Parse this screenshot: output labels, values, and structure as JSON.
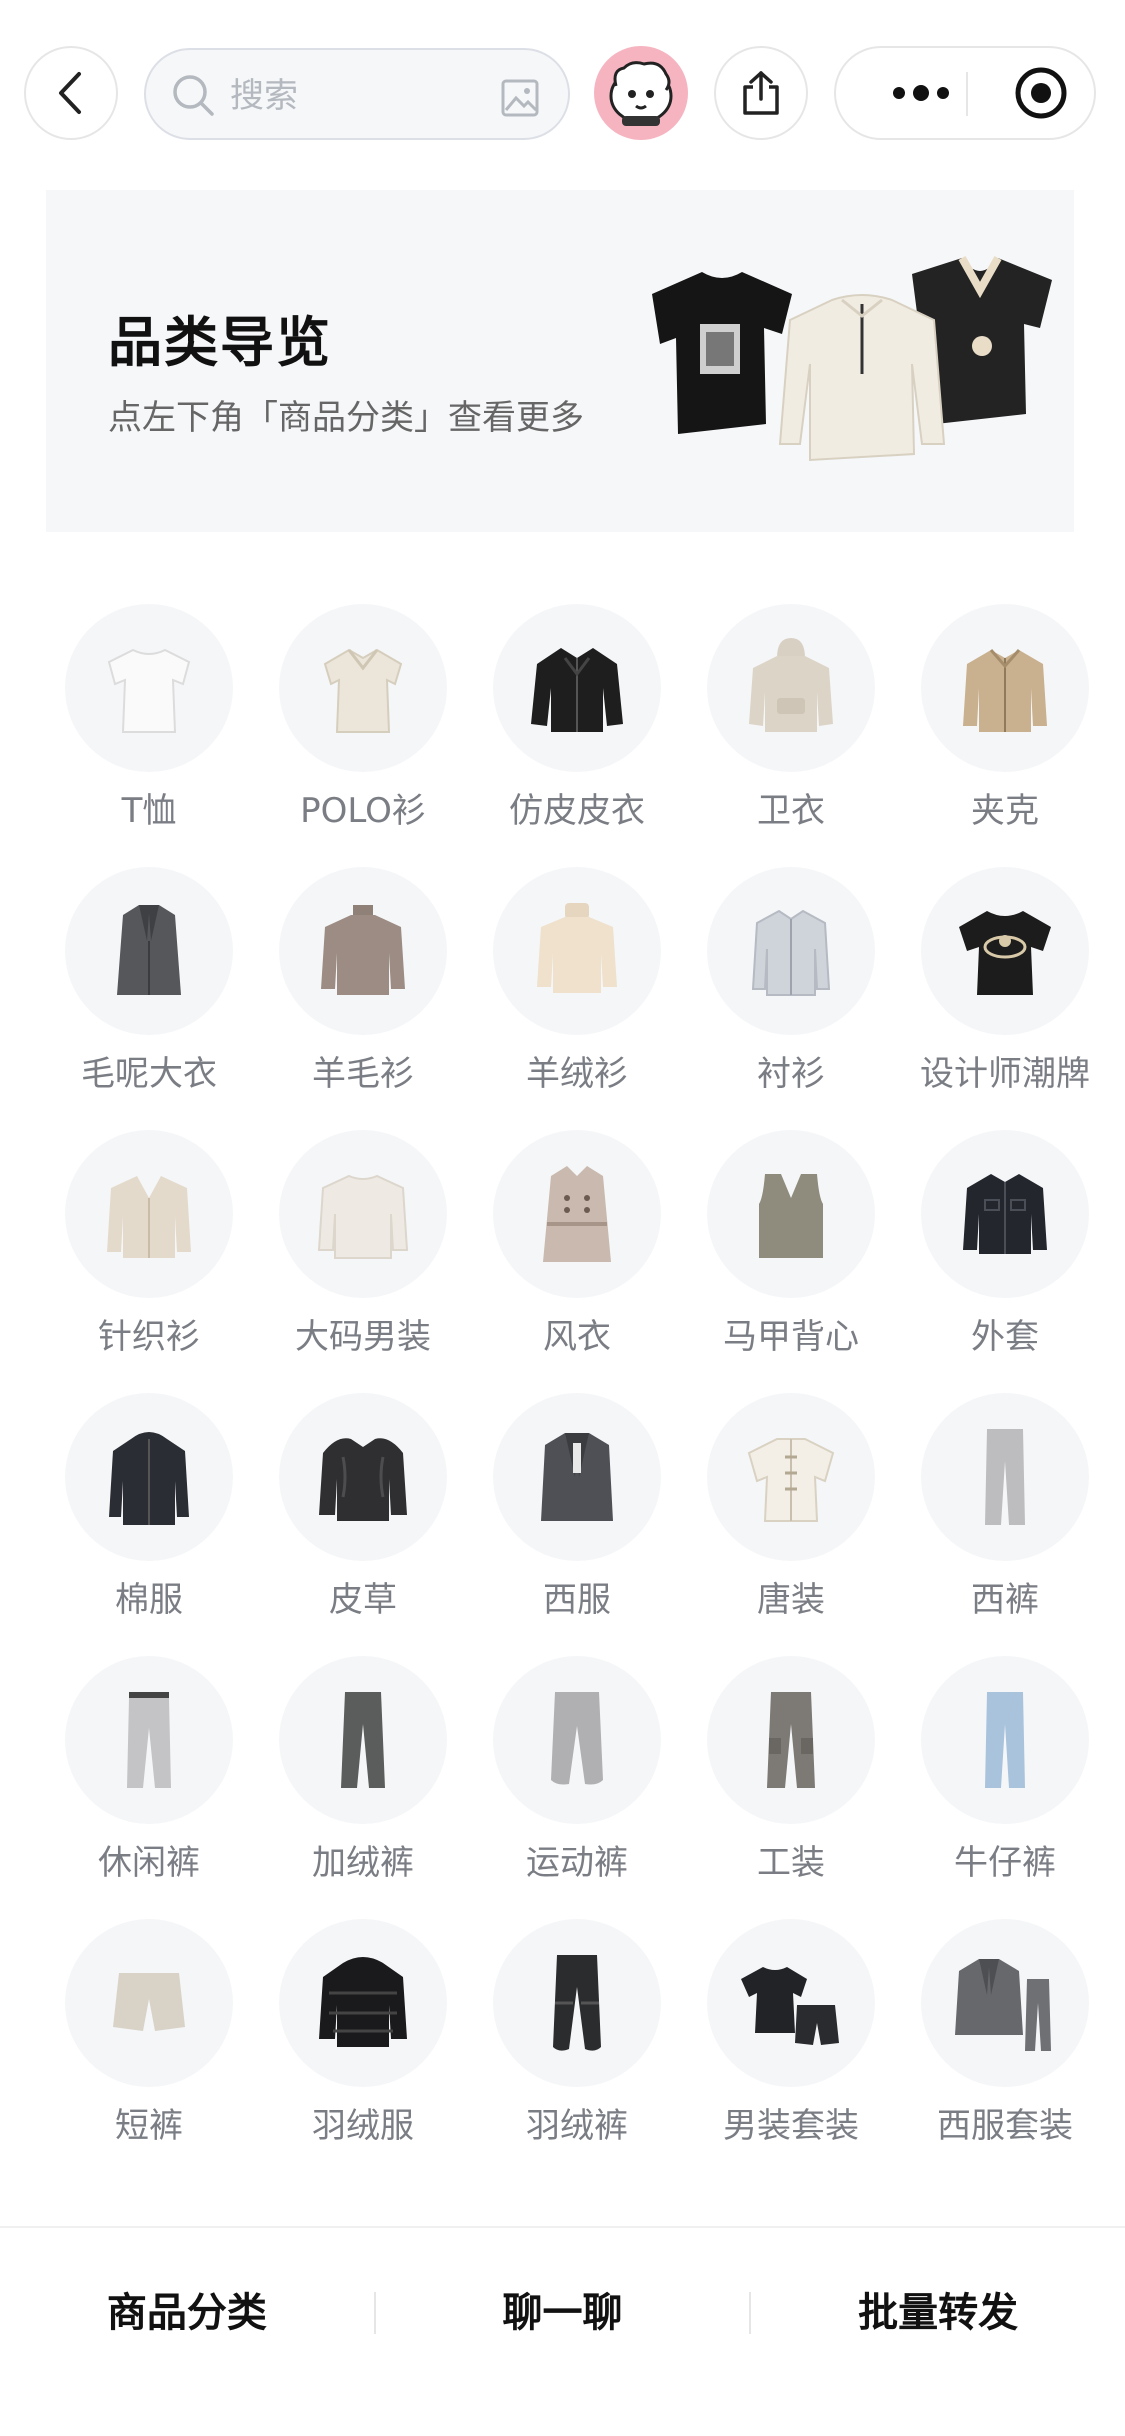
{
  "header": {
    "search_placeholder": "搜索",
    "icons": [
      "back-icon",
      "search-icon",
      "image-search-icon",
      "mascot-avatar",
      "share-icon",
      "more-icon",
      "target-icon"
    ]
  },
  "banner": {
    "title": "品类导览",
    "subtitle": "点左下角「商品分类」查看更多"
  },
  "categories": [
    {
      "label": "T恤",
      "icon": "tshirt"
    },
    {
      "label": "POLO衫",
      "icon": "polo"
    },
    {
      "label": "仿皮皮衣",
      "icon": "leather-jacket"
    },
    {
      "label": "卫衣",
      "icon": "hoodie"
    },
    {
      "label": "夹克",
      "icon": "jacket"
    },
    {
      "label": "毛呢大衣",
      "icon": "wool-coat"
    },
    {
      "label": "羊毛衫",
      "icon": "wool-sweater"
    },
    {
      "label": "羊绒衫",
      "icon": "cashmere-sweater"
    },
    {
      "label": "衬衫",
      "icon": "shirt"
    },
    {
      "label": "设计师潮牌",
      "icon": "designer-tee"
    },
    {
      "label": "针织衫",
      "icon": "cardigan"
    },
    {
      "label": "大码男装",
      "icon": "plus-size"
    },
    {
      "label": "风衣",
      "icon": "trench-coat"
    },
    {
      "label": "马甲背心",
      "icon": "vest"
    },
    {
      "label": "外套",
      "icon": "denim-jacket"
    },
    {
      "label": "棉服",
      "icon": "padded-coat"
    },
    {
      "label": "皮草",
      "icon": "fur"
    },
    {
      "label": "西服",
      "icon": "blazer"
    },
    {
      "label": "唐装",
      "icon": "tang-suit"
    },
    {
      "label": "西裤",
      "icon": "trousers"
    },
    {
      "label": "休闲裤",
      "icon": "casual-pants"
    },
    {
      "label": "加绒裤",
      "icon": "fleece-pants"
    },
    {
      "label": "运动裤",
      "icon": "sweatpants"
    },
    {
      "label": "工装",
      "icon": "cargo-pants"
    },
    {
      "label": "牛仔裤",
      "icon": "jeans"
    },
    {
      "label": "短裤",
      "icon": "shorts"
    },
    {
      "label": "羽绒服",
      "icon": "down-jacket"
    },
    {
      "label": "羽绒裤",
      "icon": "down-pants"
    },
    {
      "label": "男装套装",
      "icon": "set"
    },
    {
      "label": "西服套装",
      "icon": "suit-set"
    }
  ],
  "bottom_bar": {
    "tabs": [
      "商品分类",
      "聊一聊",
      "批量转发"
    ]
  }
}
